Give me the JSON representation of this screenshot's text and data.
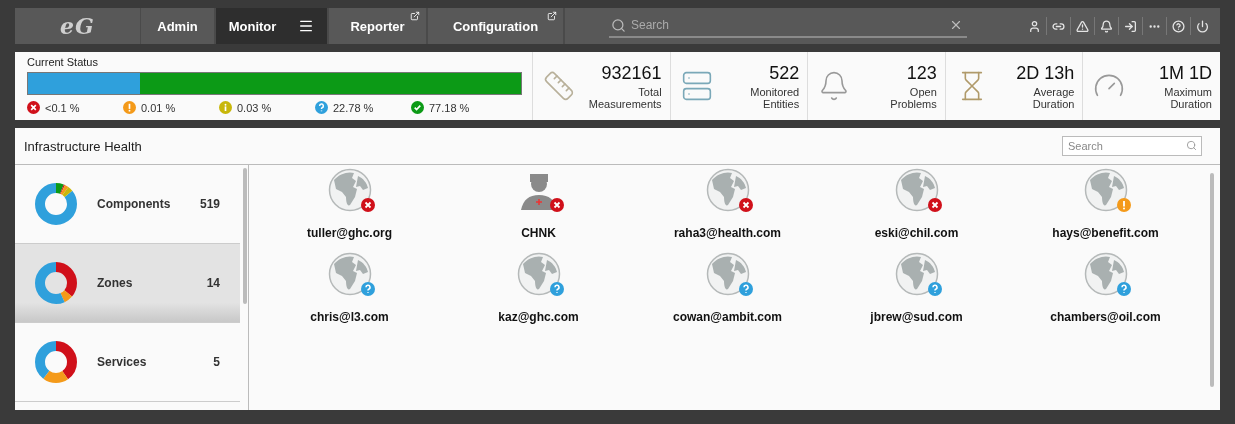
{
  "nav": {
    "logo": "eG",
    "tabs": [
      {
        "label": "Admin",
        "selected": false,
        "external": false,
        "menu": false
      },
      {
        "label": "Monitor",
        "selected": true,
        "external": false,
        "menu": true
      },
      {
        "label": "Reporter",
        "selected": false,
        "external": true,
        "menu": false
      },
      {
        "label": "Configuration",
        "selected": false,
        "external": true,
        "menu": false
      }
    ],
    "search": {
      "placeholder": "Search"
    }
  },
  "current_status": {
    "title": "Current Status",
    "segments": [
      {
        "level": 0.2278,
        "color": "#2fa0dc"
      },
      {
        "level": 0.7718,
        "color": "#0c9a16"
      }
    ],
    "legend": [
      {
        "kind": "critical",
        "value": "<0.1 %"
      },
      {
        "kind": "major",
        "value": "0.01 %"
      },
      {
        "kind": "minor",
        "value": "0.03 %"
      },
      {
        "kind": "unknown",
        "value": "22.78 %"
      },
      {
        "kind": "normal",
        "value": "77.18 %"
      }
    ]
  },
  "stats": [
    {
      "kind": "ruler",
      "value": "932161",
      "label": [
        "Total",
        "Measurements"
      ]
    },
    {
      "kind": "server",
      "value": "522",
      "label": [
        "Monitored",
        "Entities"
      ]
    },
    {
      "kind": "bell",
      "value": "123",
      "label": [
        "Open",
        "Problems"
      ]
    },
    {
      "kind": "hourglass",
      "value": "2D 13h",
      "label": [
        "Average",
        "Duration"
      ]
    },
    {
      "kind": "gauge",
      "value": "1M 1D",
      "label": [
        "Maximum",
        "Duration"
      ]
    }
  ],
  "infrastructure_health": {
    "title": "Infrastructure Health",
    "search": {
      "placeholder": "Search"
    },
    "categories": [
      {
        "name": "Components",
        "count": "519",
        "selected": false
      },
      {
        "name": "Zones",
        "count": "14",
        "selected": true
      },
      {
        "name": "Services",
        "count": "5",
        "selected": false
      }
    ],
    "nodes": [
      {
        "name": "tuller@ghc.org",
        "kind": "globe",
        "badge": {
          "kind": "critical"
        }
      },
      {
        "name": "CHNK",
        "kind": "person",
        "badge": {
          "kind": "critical"
        }
      },
      {
        "name": "raha3@health.com",
        "kind": "globe",
        "badge": {
          "kind": "critical"
        }
      },
      {
        "name": "eski@chil.com",
        "kind": "globe",
        "badge": {
          "kind": "critical"
        }
      },
      {
        "name": "hays@benefit.com",
        "kind": "globe",
        "badge": {
          "kind": "major"
        }
      },
      {
        "name": "chris@l3.com",
        "kind": "globe",
        "badge": {
          "kind": "unknown"
        }
      },
      {
        "name": "kaz@ghc.com",
        "kind": "globe",
        "badge": {
          "kind": "unknown"
        }
      },
      {
        "name": "cowan@ambit.com",
        "kind": "globe",
        "badge": {
          "kind": "unknown"
        }
      },
      {
        "name": "jbrew@sud.com",
        "kind": "globe",
        "badge": {
          "kind": "unknown"
        }
      },
      {
        "name": "chambers@oil.com",
        "kind": "globe",
        "badge": {
          "kind": "unknown"
        }
      }
    ]
  }
}
